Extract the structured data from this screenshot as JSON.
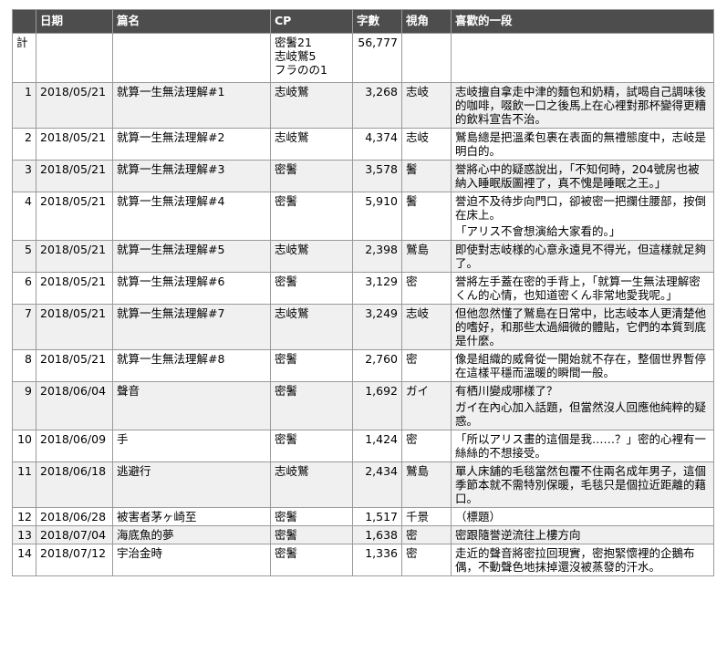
{
  "headers": [
    "",
    "日期",
    "篇名",
    "CP",
    "字數",
    "視角",
    "喜歡的一段"
  ],
  "total": {
    "label": "計",
    "cp": [
      "密鬐21",
      "志岐鷲5",
      "フラのの1"
    ],
    "chars": "56,777"
  },
  "rows": [
    {
      "no": "1",
      "date": "2018/05/21",
      "title": "就算一生無法理解#1",
      "cp": "志岐鷲",
      "chars": "3,268",
      "pov": "志岐",
      "quote": [
        "志岐擅自拿走中津的麵包和奶精，試喝自己調味後的咖啡，啜飲一口之後馬上在心裡對那杯變得更糟的飲料宣告不治。"
      ]
    },
    {
      "no": "2",
      "date": "2018/05/21",
      "title": "就算一生無法理解#2",
      "cp": "志岐鷲",
      "chars": "4,374",
      "pov": "志岐",
      "quote": [
        "鷲島總是把溫柔包裹在表面的無禮態度中，志岐是明白的。"
      ]
    },
    {
      "no": "3",
      "date": "2018/05/21",
      "title": "就算一生無法理解#3",
      "cp": "密鬐",
      "chars": "3,578",
      "pov": "鬐",
      "quote": [
        "誉將心中的疑惑說出，「不知何時，204號房也被納入睡眠版圖裡了，真不愧是睡眠之王。」"
      ]
    },
    {
      "no": "4",
      "date": "2018/05/21",
      "title": "就算一生無法理解#4",
      "cp": "密鬐",
      "chars": "5,910",
      "pov": "鬐",
      "quote": [
        "誉迫不及待步向門口，卻被密一把攔住腰部，按倒在床上。",
        "「アリス不會想演給大家看的。」"
      ]
    },
    {
      "no": "5",
      "date": "2018/05/21",
      "title": "就算一生無法理解#5",
      "cp": "志岐鷲",
      "chars": "2,398",
      "pov": "鷲島",
      "quote": [
        "即使對志岐様的心意永遠見不得光，但這樣就足夠了。"
      ]
    },
    {
      "no": "6",
      "date": "2018/05/21",
      "title": "就算一生無法理解#6",
      "cp": "密鬐",
      "chars": "3,129",
      "pov": "密",
      "quote": [
        "誉將左手蓋在密的手背上，「就算一生無法理解密くん的心情，也知道密くん非常地愛我呢。」"
      ]
    },
    {
      "no": "7",
      "date": "2018/05/21",
      "title": "就算一生無法理解#7",
      "cp": "志岐鷲",
      "chars": "3,249",
      "pov": "志岐",
      "quote": [
        "但他忽然懂了鷲島在日常中，比志岐本人更清楚他的嗜好，和那些太過細微的體貼，它們的本質到底是什麼。"
      ]
    },
    {
      "no": "8",
      "date": "2018/05/21",
      "title": "就算一生無法理解#8",
      "cp": "密鬐",
      "chars": "2,760",
      "pov": "密",
      "quote": [
        "像是組織的威脅從一開始就不存在，整個世界暫停在這樣平穩而溫暖的瞬間一般。"
      ]
    },
    {
      "no": "9",
      "date": "2018/06/04",
      "title": "聲音",
      "cp": "密鬐",
      "chars": "1,692",
      "pov": "ガイ",
      "quote": [
        "有栖川變成哪樣了？",
        "ガイ在內心加入話題，但當然沒人回應他純粹的疑惑。"
      ]
    },
    {
      "no": "10",
      "date": "2018/06/09",
      "title": "手",
      "cp": "密鬐",
      "chars": "1,424",
      "pov": "密",
      "quote": [
        "「所以アリス畫的這個是我……？」密的心裡有一絲絲的不想接受。"
      ]
    },
    {
      "no": "11",
      "date": "2018/06/18",
      "title": "逃避行",
      "cp": "志岐鷲",
      "chars": "2,434",
      "pov": "鷲島",
      "quote": [
        "單人床舖的毛毯當然包覆不住兩名成年男子，這個季節本就不需特別保暖，毛毯只是個拉近距離的藉口。"
      ]
    },
    {
      "no": "12",
      "date": "2018/06/28",
      "title": "被害者茅ヶ崎至",
      "cp": "密鬐",
      "chars": "1,517",
      "pov": "千景",
      "quote": [
        "（標題）"
      ]
    },
    {
      "no": "13",
      "date": "2018/07/04",
      "title": "海底魚的夢",
      "cp": "密鬐",
      "chars": "1,638",
      "pov": "密",
      "quote": [
        "密跟隨誉逆流往上樓方向"
      ]
    },
    {
      "no": "14",
      "date": "2018/07/12",
      "title": "宇治金時",
      "cp": "密鬐",
      "chars": "1,336",
      "pov": "密",
      "quote": [
        "走近的聲音將密拉回現實，密抱緊懷裡的企鵝布偶，不動聲色地抹掉還沒被蒸發的汗水。"
      ]
    }
  ]
}
